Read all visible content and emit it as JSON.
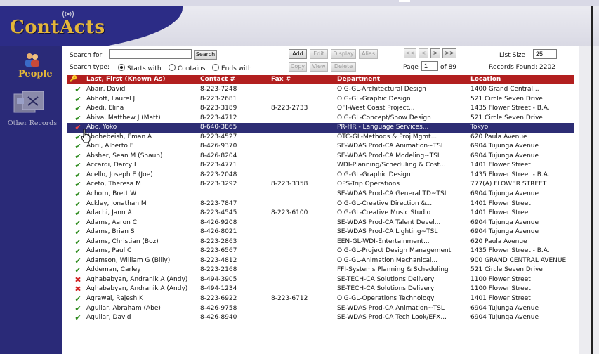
{
  "app": {
    "logo_text": "ContActs"
  },
  "nav": {
    "people_label": "People",
    "other_label": "Other Records"
  },
  "search": {
    "label": "Search for:",
    "value": "",
    "button": "Search",
    "type_label": "Search type:",
    "type_options": [
      "Starts with",
      "Contains",
      "Ends with"
    ],
    "type_selected": "Starts with"
  },
  "actions": {
    "add": "Add",
    "edit": "Edit",
    "display": "Display",
    "alias": "Alias",
    "copy": "Copy",
    "view": "View",
    "delete": "Delete"
  },
  "pager": {
    "first": "<<",
    "prev": "<",
    "next": ">",
    "last": ">>",
    "page_label": "Page",
    "page_value": "1",
    "of_label": "of 89"
  },
  "list": {
    "size_label": "List Size",
    "size_value": "25",
    "found_label": "Records Found: 2202"
  },
  "columns": {
    "name": "Last, First (Known As)",
    "contact": "Contact #",
    "fax": "Fax #",
    "department": "Department",
    "location": "Location"
  },
  "status_colors": {
    "ok": "#2e8b1e",
    "deleted": "#d02020",
    "selected_row": "#2d2d74",
    "header": "#b21f1f"
  },
  "rows": [
    {
      "status": "ok",
      "name": "Abair, David",
      "contact": "8-223-7248",
      "fax": "",
      "dept": "OIG-GL-Architectural Design",
      "loc": "1400 Grand Central..."
    },
    {
      "status": "ok",
      "name": "Abbott, Laurel J",
      "contact": "8-223-2681",
      "fax": "",
      "dept": "OIG-GL-Graphic Design",
      "loc": "521 Circle Seven Drive"
    },
    {
      "status": "ok",
      "name": "Abedi, Elina",
      "contact": "8-223-3189",
      "fax": "8-223-2733",
      "dept": "OFI-West Coast Project...",
      "loc": "1435 Flower Street - B.A."
    },
    {
      "status": "ok",
      "name": "Abiva, Matthew J (Matt)",
      "contact": "8-223-4712",
      "fax": "",
      "dept": "OIG-GL-Concept/Show Design",
      "loc": "521 Circle Seven Drive"
    },
    {
      "status": "ok",
      "name": "Abo, Yoko",
      "contact": "8-640-3865",
      "fax": "",
      "dept": "PR-HR - Language Services...",
      "loc": "Tokyo",
      "selected": true
    },
    {
      "status": "ok",
      "name": "Abohebeish, Eman A",
      "contact": "8-223-4527",
      "fax": "",
      "dept": "OTC-GL-Methods & Proj Mgmt...",
      "loc": "620 Paula Avenue"
    },
    {
      "status": "ok",
      "name": "Abril, Alberto E",
      "contact": "8-426-9370",
      "fax": "",
      "dept": "SE-WDAS Prod-CA Animation~TSL",
      "loc": "6904 Tujunga Avenue"
    },
    {
      "status": "ok",
      "name": "Absher, Sean M (Shaun)",
      "contact": "8-426-8204",
      "fax": "",
      "dept": "SE-WDAS Prod-CA Modeling~TSL",
      "loc": "6904 Tujunga Avenue"
    },
    {
      "status": "ok",
      "name": "Accardi, Darcy L",
      "contact": "8-223-4771",
      "fax": "",
      "dept": "WDI-Planning/Scheduling & Cost...",
      "loc": "1401 Flower Street"
    },
    {
      "status": "ok",
      "name": "Acello, Joseph E (Joe)",
      "contact": "8-223-2048",
      "fax": "",
      "dept": "OIG-GL-Graphic Design",
      "loc": "1435 Flower Street - B.A."
    },
    {
      "status": "ok",
      "name": "Aceto, Theresa M",
      "contact": "8-223-3292",
      "fax": "8-223-3358",
      "dept": "OPS-Trip Operations",
      "loc": "777(A) FLOWER STREET"
    },
    {
      "status": "ok",
      "name": "Achorn, Brett W",
      "contact": "",
      "fax": "",
      "dept": "SE-WDAS Prod-CA General TD~TSL",
      "loc": "6904 Tujunga Avenue"
    },
    {
      "status": "ok",
      "name": "Ackley, Jonathan M",
      "contact": "8-223-7847",
      "fax": "",
      "dept": "OIG-GL-Creative Direction &...",
      "loc": "1401 Flower Street"
    },
    {
      "status": "ok",
      "name": "Adachi, Jann A",
      "contact": "8-223-4545",
      "fax": "8-223-6100",
      "dept": "OIG-GL-Creative Music Studio",
      "loc": "1401 Flower Street"
    },
    {
      "status": "ok",
      "name": "Adams, Aaron C",
      "contact": "8-426-9208",
      "fax": "",
      "dept": "SE-WDAS Prod-CA Talent Devel...",
      "loc": "6904 Tujunga Avenue"
    },
    {
      "status": "ok",
      "name": "Adams, Brian S",
      "contact": "8-426-8021",
      "fax": "",
      "dept": "SE-WDAS Prod-CA Lighting~TSL",
      "loc": "6904 Tujunga Avenue"
    },
    {
      "status": "ok",
      "name": "Adams, Christian (Boz)",
      "contact": "8-223-2863",
      "fax": "",
      "dept": "EEN-GL-WDI-Entertainment...",
      "loc": "620 Paula Avenue"
    },
    {
      "status": "ok",
      "name": "Adams, Paul C",
      "contact": "8-223-6567",
      "fax": "",
      "dept": "OIG-GL-Project Design Management",
      "loc": "1435 Flower Street - B.A."
    },
    {
      "status": "ok",
      "name": "Adamson, William G (Billy)",
      "contact": "8-223-4812",
      "fax": "",
      "dept": "OIG-GL-Animation Mechanical...",
      "loc": "900 GRAND CENTRAL AVENUE"
    },
    {
      "status": "ok",
      "name": "Addeman, Carley",
      "contact": "8-223-2168",
      "fax": "",
      "dept": "FFI-Systems Planning & Scheduling",
      "loc": "521 Circle Seven Drive"
    },
    {
      "status": "deleted",
      "name": "Aghababyan, Andranik A (Andy)",
      "contact": "8-494-3905",
      "fax": "",
      "dept": "SE-TECH-CA Solutions Delivery",
      "loc": "1100 Flower Street"
    },
    {
      "status": "deleted",
      "name": "Aghababyan, Andranik A (Andy)",
      "contact": "8-494-1234",
      "fax": "",
      "dept": "SE-TECH-CA Solutions Delivery",
      "loc": "1100 Flower Street"
    },
    {
      "status": "ok",
      "name": "Agrawal, Rajesh K",
      "contact": "8-223-6922",
      "fax": "8-223-6712",
      "dept": "OIG-GL-Operations Technology",
      "loc": "1401 Flower Street"
    },
    {
      "status": "ok",
      "name": "Aguilar, Abraham (Abe)",
      "contact": "8-426-9758",
      "fax": "",
      "dept": "SE-WDAS Prod-CA Animation~TSL",
      "loc": "6904 Tujunga Avenue"
    },
    {
      "status": "ok",
      "name": "Aguilar, David",
      "contact": "8-426-8940",
      "fax": "",
      "dept": "SE-WDAS Prod-CA Tech Look/EFX...",
      "loc": "6904 Tujunga Avenue"
    }
  ]
}
